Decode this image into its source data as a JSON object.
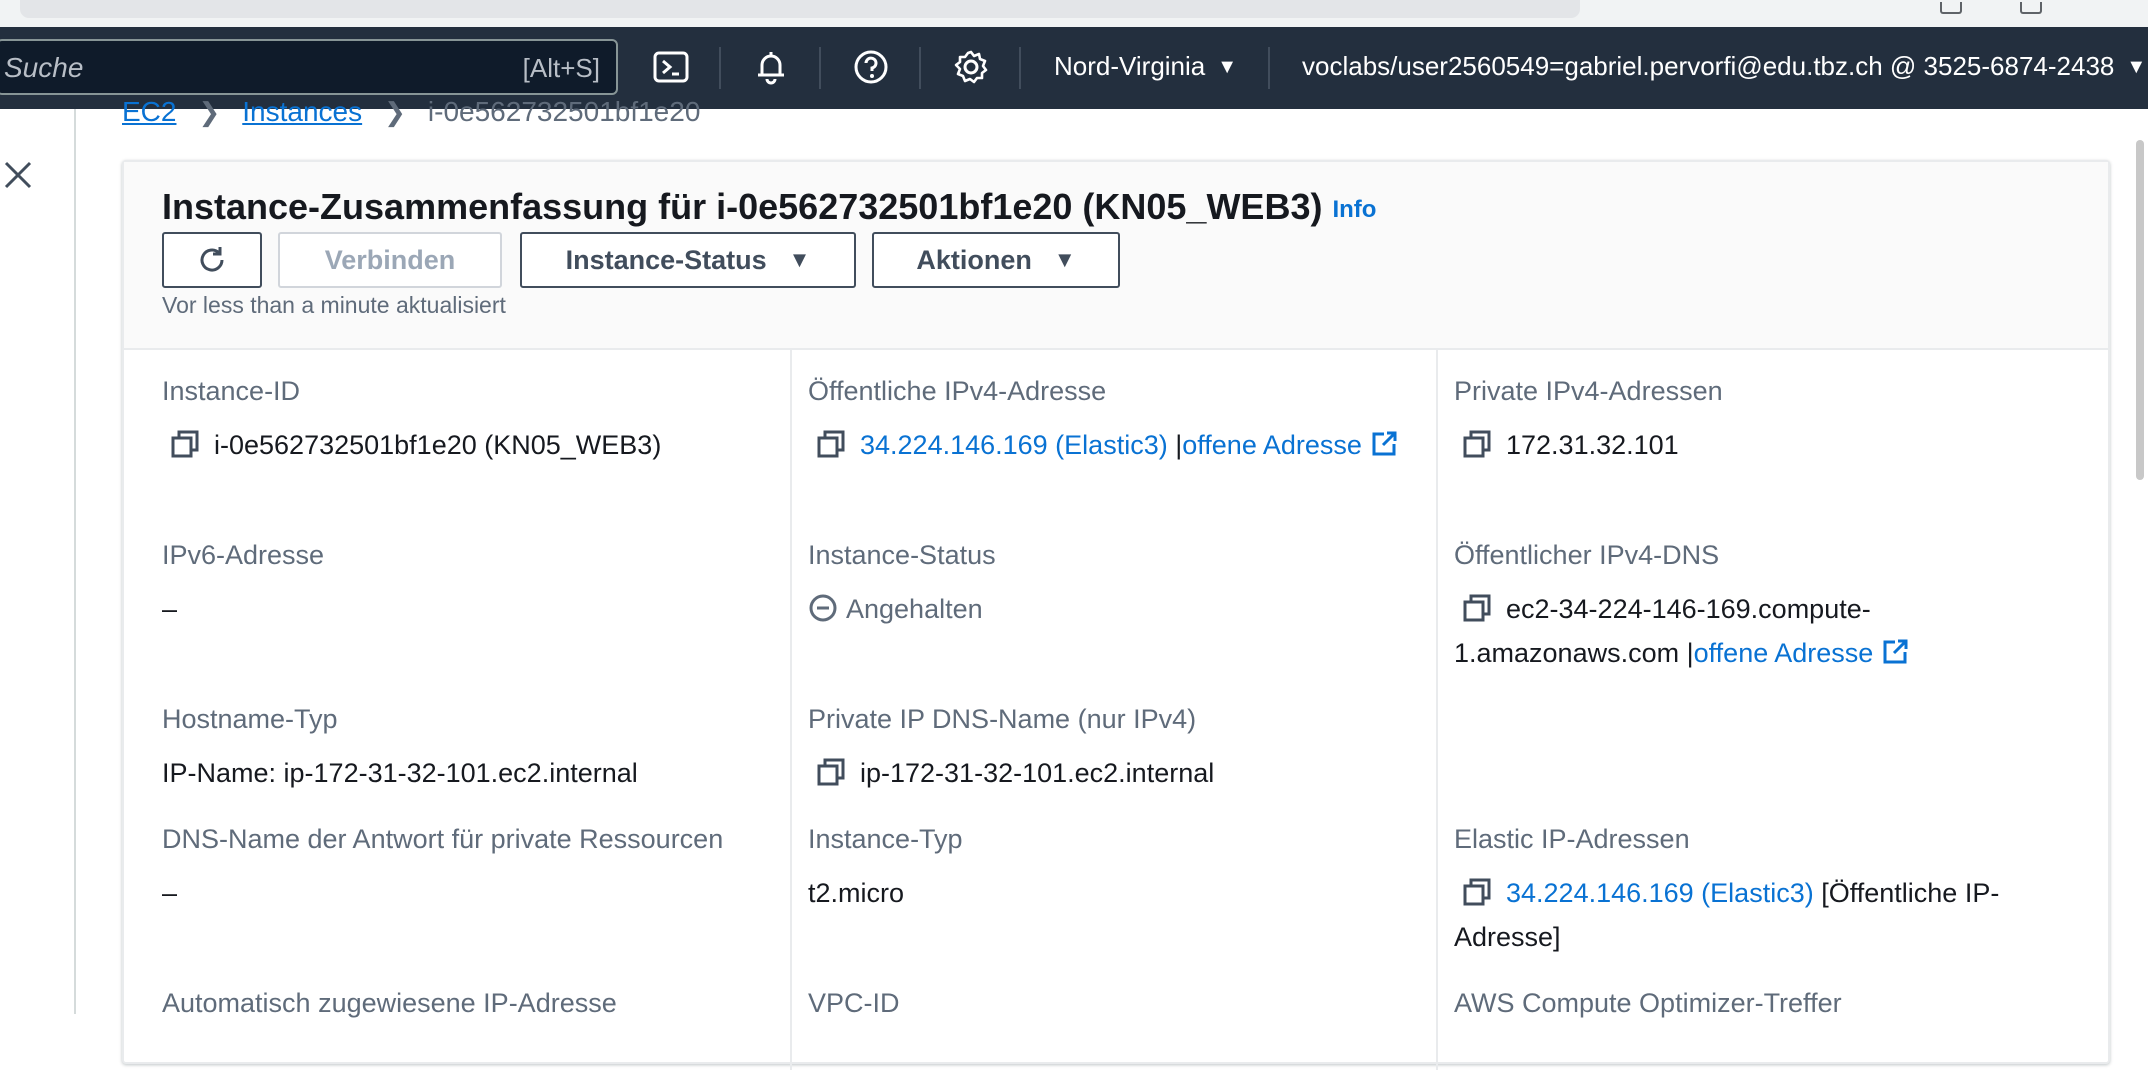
{
  "topnav": {
    "search_placeholder": "Suche",
    "search_shortcut": "[Alt+S]",
    "region": "Nord-Virginia",
    "account": "voclabs/user2560549=gabriel.pervorfi@edu.tbz.ch @ 3525-6874-2438",
    "icons": [
      "cloudshell-icon",
      "bell-icon",
      "help-icon",
      "gear-icon"
    ]
  },
  "breadcrumb": {
    "items": [
      "EC2",
      "Instances"
    ],
    "current": "i-0e562732501bf1e20"
  },
  "summary": {
    "title": "Instance-Zusammenfassung für i-0e562732501bf1e20 (KN05_WEB3)",
    "info": "Info",
    "buttons": {
      "connect": "Verbinden",
      "instance_state": "Instance-Status",
      "actions": "Aktionen"
    },
    "updated": "Vor less than a minute aktualisiert"
  },
  "details": {
    "instance_id": {
      "label": "Instance-ID",
      "value": "i-0e562732501bf1e20 (KN05_WEB3)"
    },
    "public_ipv4": {
      "label": "Öffentliche IPv4-Adresse",
      "value": "34.224.146.169 (Elastic3)",
      "sep": "|",
      "open": "offene Adresse"
    },
    "private_ipv4": {
      "label": "Private IPv4-Adressen",
      "value": "172.31.32.101"
    },
    "ipv6": {
      "label": "IPv6-Adresse",
      "value": "–"
    },
    "instance_state": {
      "label": "Instance-Status",
      "value": "Angehalten"
    },
    "public_dns": {
      "label": "Öffentlicher IPv4-DNS",
      "value": "ec2-34-224-146-169.compute-1.amazonaws.com",
      "sep": "|",
      "open": "offene Adresse"
    },
    "hostname_type": {
      "label": "Hostname-Typ",
      "value": "IP-Name: ip-172-31-32-101.ec2.internal"
    },
    "private_dns": {
      "label": "Private IP DNS-Name (nur IPv4)",
      "value": "ip-172-31-32-101.ec2.internal"
    },
    "dns_answer": {
      "label": "DNS-Name der Antwort für private Ressourcen",
      "value": "–"
    },
    "instance_type": {
      "label": "Instance-Typ",
      "value": "t2.micro"
    },
    "elastic_ip": {
      "label": "Elastic IP-Adressen",
      "value": "34.224.146.169 (Elastic3)",
      "suffix": "[Öffentliche IP-Adresse]"
    },
    "auto_ip": {
      "label": "Automatisch zugewiesene IP-Adresse"
    },
    "vpc": {
      "label": "VPC-ID"
    },
    "optimizer": {
      "label": "AWS Compute Optimizer-Treffer"
    }
  },
  "colors": {
    "nav_bg": "#232f3e",
    "link": "#0972d3",
    "label": "#5f6b7a",
    "text": "#16191f"
  }
}
